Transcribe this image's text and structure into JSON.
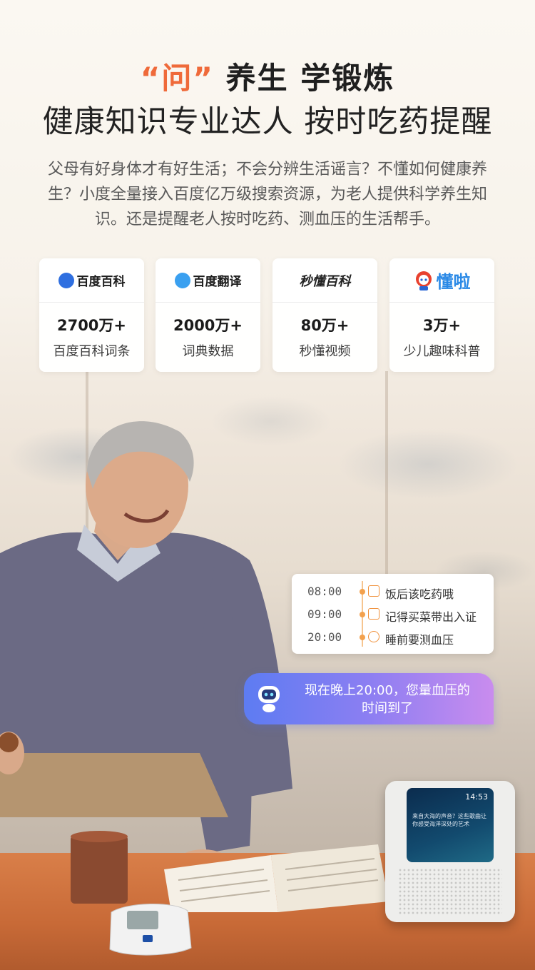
{
  "header": {
    "headline_accent": "“问”",
    "headline_rest": "养生 学锻炼",
    "subheadline": "健康知识专业达人 按时吃药提醒",
    "intro": "父母有好身体才有好生活；不会分辨生活谣言？不懂如何健康养生？小度全量接入百度亿万级搜索资源，为老人提供科学养生知识。还是提醒老人按时吃药、测血压的生活帮手。"
  },
  "cards": [
    {
      "logo_text": "百度百科",
      "logo_icon": "baidu-baike-icon",
      "value": "2700万+",
      "caption": "百度百科词条"
    },
    {
      "logo_text": "百度翻译",
      "logo_icon": "baidu-translate-icon",
      "value": "2000万+",
      "caption": "词典数据"
    },
    {
      "logo_text": "秒懂百科",
      "logo_icon": "miaodong-baike-logo",
      "value": "80万+",
      "caption": "秒懂视频"
    },
    {
      "logo_text": "懂啦",
      "logo_icon": "dongla-robot-icon",
      "value": "3万+",
      "caption": "少儿趣味科普"
    }
  ],
  "schedule": [
    {
      "time": "08:00",
      "icon": "pill-box-icon",
      "text": "饭后该吃药哦"
    },
    {
      "time": "09:00",
      "icon": "id-card-icon",
      "text": "记得买菜带出入证"
    },
    {
      "time": "20:00",
      "icon": "blood-pressure-icon",
      "text": "睡前要测血压"
    }
  ],
  "assistant": {
    "icon": "robot-icon",
    "message_line1": "现在晚上20:00，您量血压的",
    "message_line2": "时间到了"
  },
  "device": {
    "clock": "14:53",
    "screen_text": "来自大海的声音？这些歌曲让你感受海洋深处的艺术"
  },
  "colors": {
    "accent": "#ef6a3a",
    "bubble_start": "#5d7cf2",
    "bubble_end": "#c98cee",
    "timeline": "#f3a14d"
  }
}
